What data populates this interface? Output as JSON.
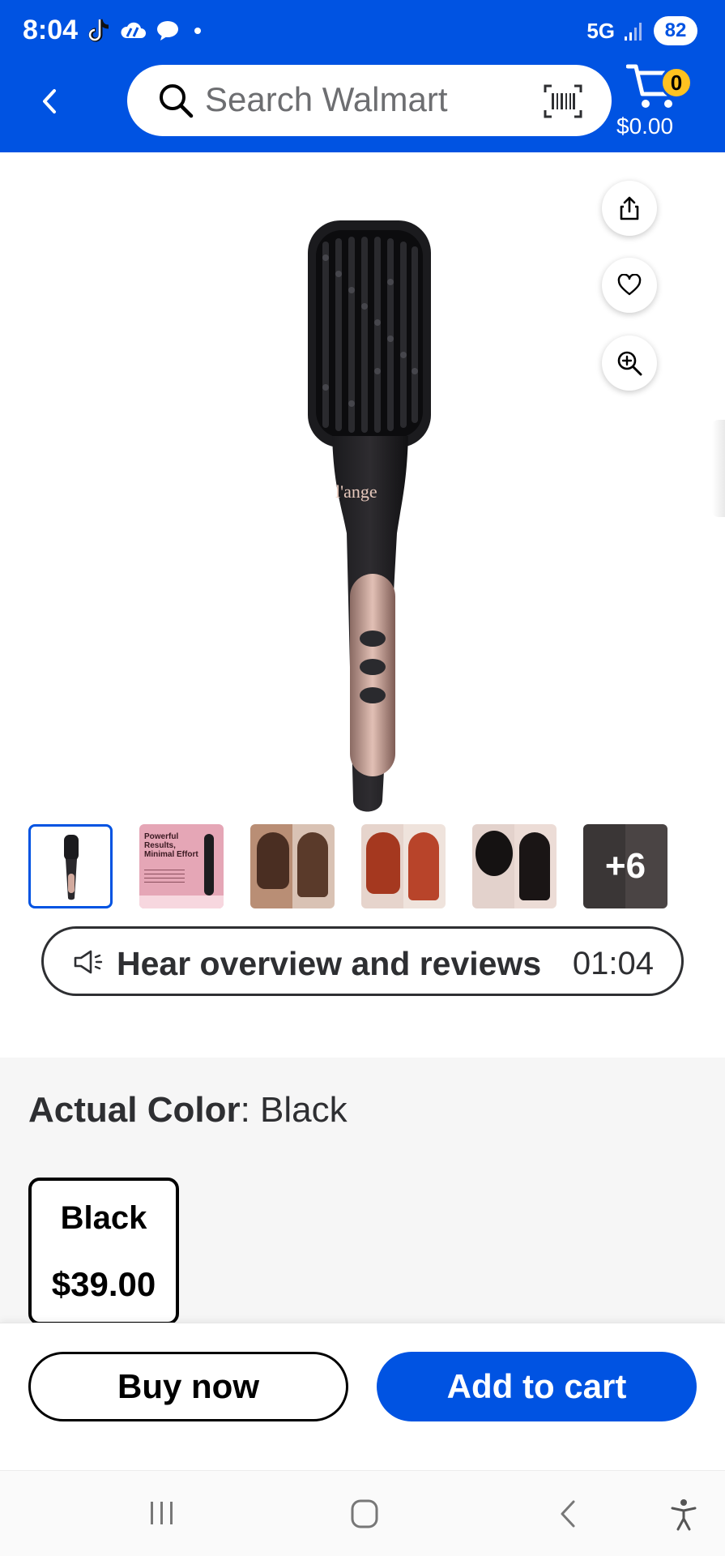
{
  "status_bar": {
    "time": "8:04",
    "network": "5G",
    "battery": "82"
  },
  "header": {
    "search_placeholder": "Search Walmart",
    "cart_count": "0",
    "cart_total": "$0.00"
  },
  "product_media": {
    "brand_on_product": "l'ange",
    "thumbnails": [
      {
        "name": "thumb-1",
        "selected": true
      },
      {
        "name": "thumb-2",
        "title": "Powerful Results, Minimal Effort"
      },
      {
        "name": "thumb-3"
      },
      {
        "name": "thumb-4"
      },
      {
        "name": "thumb-5"
      },
      {
        "name": "thumb-6",
        "more_label": "+6"
      }
    ]
  },
  "audio_overview": {
    "label": "Hear overview and reviews",
    "duration": "01:04"
  },
  "variant": {
    "label": "Actual Color",
    "separator": ": ",
    "selected_value": "Black",
    "options": [
      {
        "name": "Black",
        "price": "$39.00"
      }
    ]
  },
  "actions": {
    "buy_now": "Buy now",
    "add_to_cart": "Add to cart"
  },
  "colors": {
    "brand_blue": "#0053e2",
    "cart_badge": "#ffc220",
    "section_bg": "#f6f6f6"
  },
  "icons": [
    "back-icon",
    "search-icon",
    "barcode-icon",
    "cart-icon",
    "share-icon",
    "heart-icon",
    "zoom-icon",
    "speaker-icon",
    "recents-icon",
    "home-icon",
    "nav-back-icon",
    "accessibility-icon"
  ]
}
